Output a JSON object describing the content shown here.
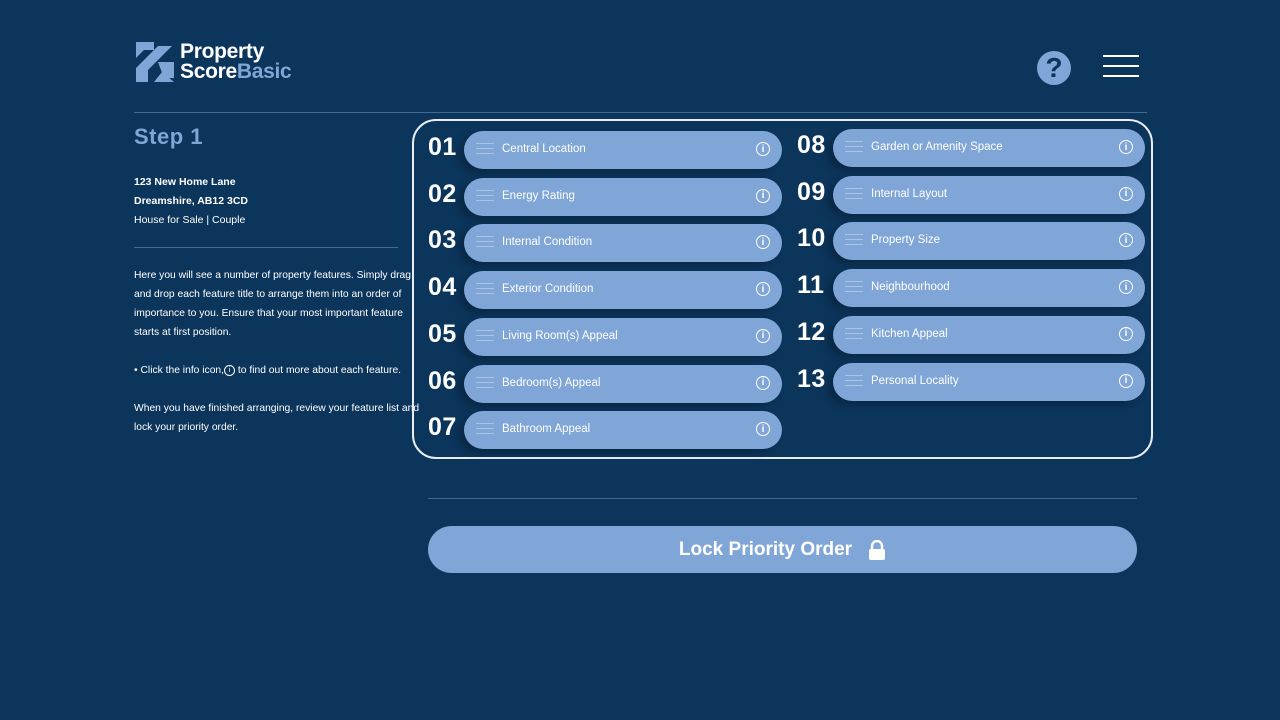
{
  "brand": {
    "line1": "Property",
    "line2a": "Score",
    "line2b": "Basic"
  },
  "header": {
    "help_label": "?",
    "menu_icon": "hamburger-menu-icon"
  },
  "step": {
    "title": "Step 1"
  },
  "property": {
    "street": "123 New Home Lane",
    "town": "Dreamshire, AB12 3CD",
    "type": "House for Sale | Couple"
  },
  "instructions": {
    "p1": "Here you will see a number of property features. Simply drag and drop each feature title to arrange them  into an order of importance to you. Ensure that your most important feature starts at first position.",
    "p2a": "• Click the info icon,",
    "p2b": " to find out more about each feature.",
    "p3": "When you have finished arranging, review your feature list and lock your priority order."
  },
  "features": [
    {
      "num": "01",
      "label": "Central Location"
    },
    {
      "num": "02",
      "label": "Energy Rating"
    },
    {
      "num": "03",
      "label": "Internal Condition"
    },
    {
      "num": "04",
      "label": "Exterior Condition"
    },
    {
      "num": "05",
      "label": "Living Room(s) Appeal"
    },
    {
      "num": "06",
      "label": "Bedroom(s) Appeal"
    },
    {
      "num": "07",
      "label": "Bathroom Appeal"
    },
    {
      "num": "08",
      "label": "Garden or Amenity Space"
    },
    {
      "num": "09",
      "label": "Internal Layout"
    },
    {
      "num": "10",
      "label": "Property Size"
    },
    {
      "num": "11",
      "label": "Neighbourhood"
    },
    {
      "num": "12",
      "label": "Kitchen Appeal"
    },
    {
      "num": "13",
      "label": "Personal Locality"
    }
  ],
  "lock_button": {
    "label": "Lock Priority Order",
    "icon": "padlock-icon"
  },
  "colors": {
    "background": "#0c355c",
    "accent": "#7fa6d6",
    "text": "#ffffff"
  }
}
